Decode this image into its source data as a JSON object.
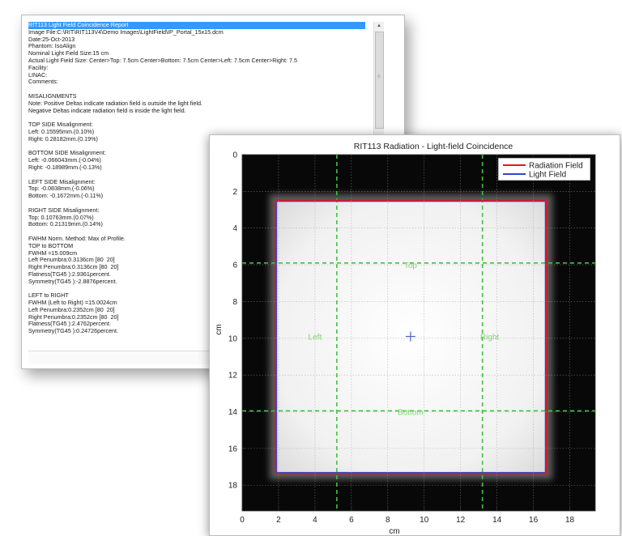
{
  "report": {
    "lines": [
      "RIT113 Light Field Coincidence Report",
      "Image File:C:\\RIT\\RIT113V4\\Demo Images\\LightField\\IP_Portal_15x15.dcm",
      "Date:25-Oct-2013",
      "Phantom: IsoAlign",
      "Nominal Light Field Size:15 cm",
      "Actual Light Field Size: Center>Top: 7.5cm Center>Bottom: 7.5cm Center>Left: 7.5cm Center>Right: 7.5",
      "Facility:",
      "LINAC:",
      "Comments:",
      "",
      "MISALIGNMENTS",
      "Note: Positive Deltas indicate radiation field is outside the light field.",
      "Negative Deltas indicate radiation field is inside the light field.",
      "",
      "TOP SIDE Misalignment:",
      "Left: 0.15595mm.(0.10%)",
      "Right: 0.28182mm.(0.19%)",
      "",
      "BOTTOM SIDE Misalignment:",
      "Left: -0.066043mm.(-0.04%)",
      "Right: -0.18989mm.(-0.13%)",
      "",
      "LEFT SIDE Misalignment:",
      "Top: -0.0838mm.(-0.06%)",
      "Bottom: -0.1672mm.(-0.11%)",
      "",
      "RIGHT SIDE Misalignment:",
      "Top: 0.10763mm.(0.07%)",
      "Bottom: 0.21319mm.(0.14%)",
      "",
      "FWHM Norm. Method: Max of Profile.",
      "TOP to BOTTOM",
      "FWHM =15.009cm",
      "Left Penumbra:0.3136cm [80  20]",
      "Right Penumbra:0.3136cm [80  20]",
      "Flatness(TG45 ):2.9361percent.",
      "Symmetry(TG45 ):-2.8876percent.",
      "",
      "LEFT to RIGHT",
      "FWHM (Left to Right) =15.0024cm",
      "Left Penumbra:0.2352cm [80  20]",
      "Right Penumbra:0.2352cm [80  20]",
      "Flatness(TG45 ):2.4762percent.",
      "Symmetry(TG45 ):0.24726percent."
    ],
    "selected_index": 0
  },
  "chart_data": {
    "type": "image",
    "title": "RIT113 Radiation - Light-field Coincidence",
    "xlabel": "cm",
    "ylabel": "cm",
    "xlim": [
      0,
      19.4
    ],
    "ylim": [
      0,
      19.4
    ],
    "y_inverted": true,
    "xticks": [
      0,
      2,
      4,
      6,
      8,
      10,
      12,
      14,
      16,
      18
    ],
    "yticks": [
      0,
      2,
      4,
      6,
      8,
      10,
      12,
      14,
      16,
      18
    ],
    "grid": true,
    "legend_position": "top-right",
    "series": [
      {
        "name": "Radiation Field",
        "color": "#e0181e",
        "rect": {
          "x0": 1.85,
          "x1": 16.7,
          "y0": 2.5,
          "y1": 17.35
        }
      },
      {
        "name": "Light Field",
        "color": "#3344cc",
        "rect": {
          "x0": 1.85,
          "x1": 16.7,
          "y0": 2.5,
          "y1": 17.35
        }
      }
    ],
    "guide_lines": {
      "color": "#3fc43a",
      "vertical": [
        5.2,
        13.2
      ],
      "horizontal": [
        5.9,
        13.95
      ]
    },
    "labels": [
      {
        "text": "Top",
        "x": 9.25,
        "y": 6.0
      },
      {
        "text": "Bottom",
        "x": 9.25,
        "y": 14.0
      },
      {
        "text": "Left",
        "x": 4.0,
        "y": 9.9
      },
      {
        "text": "Right",
        "x": 13.6,
        "y": 9.9
      }
    ],
    "center_marker": {
      "x": 9.25,
      "y": 9.9,
      "color": "#4a63c7"
    }
  }
}
